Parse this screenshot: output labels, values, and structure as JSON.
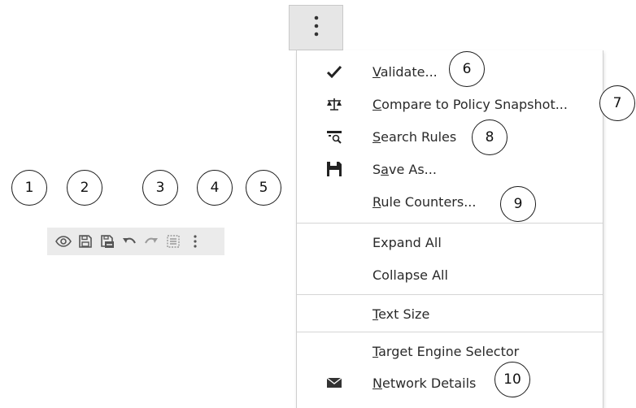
{
  "callouts": [
    "1",
    "2",
    "3",
    "4",
    "5",
    "6",
    "7",
    "8",
    "9",
    "10"
  ],
  "toolbar": {
    "buttons": [
      {
        "icon": "eye-icon"
      },
      {
        "icon": "save-icon"
      },
      {
        "icon": "save-as-icon"
      },
      {
        "icon": "undo-icon"
      },
      {
        "icon": "redo-icon"
      },
      {
        "icon": "select-all-icon"
      },
      {
        "icon": "kebab-icon"
      }
    ]
  },
  "menu": {
    "validate": {
      "pre": "",
      "key": "V",
      "post": "alidate..."
    },
    "compare": {
      "pre": "",
      "key": "C",
      "post": "ompare to Policy Snapshot..."
    },
    "search": {
      "pre": "",
      "key": "S",
      "post": "earch Rules"
    },
    "save_as": {
      "pre": "S",
      "key": "a",
      "post": "ve As..."
    },
    "rule_counters": {
      "pre": "",
      "key": "R",
      "post": "ule Counters..."
    },
    "expand_all": "Expand All",
    "collapse_all": "Collapse All",
    "text_size": {
      "pre": "",
      "key": "T",
      "post": "ext Size"
    },
    "target_engine": {
      "pre": "",
      "key": "T",
      "post": "arget Engine Selector"
    },
    "network_details": {
      "pre": "",
      "key": "N",
      "post": "etwork Details"
    }
  },
  "colors": {
    "toolbar_bg": "#ebebeb",
    "icon": "#555555",
    "menu_border": "#cfcfcf"
  }
}
